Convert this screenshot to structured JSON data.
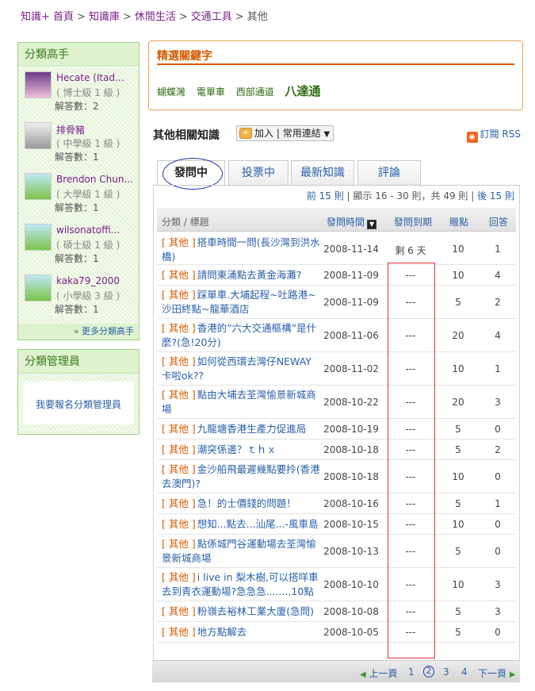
{
  "breadcrumb": [
    "知識+ 首頁",
    "知識庫",
    "休閒生活",
    "交通工具",
    "其他"
  ],
  "sidebar": {
    "experts_title": "分類高手",
    "experts": [
      {
        "name": "Hecate (Itad...",
        "grade": "( 博士級 1 級 )",
        "answers": "解答數：2",
        "avatar": "anime-girl-avatar"
      },
      {
        "name": "排骨豬",
        "grade": "( 中學級 1 級 )",
        "answers": "解答數：1",
        "avatar": "gray-doll-avatar"
      },
      {
        "name": "Brendon Chun...",
        "grade": "( 大學級 1 級 )",
        "answers": "解答數：1",
        "avatar": "green-creature-avatar"
      },
      {
        "name": "wilsonatoffi...",
        "grade": "( 碩士級 1 級 )",
        "answers": "解答數：1",
        "avatar": "green-creature-avatar"
      },
      {
        "name": "kaka79_2000",
        "grade": "( 小學級 3 級 )",
        "answers": "解答數：1",
        "avatar": "green-creature-avatar"
      }
    ],
    "more_experts": "更多分類高手",
    "admin_title": "分類管理員",
    "admin_link": "我要報名分類管理員"
  },
  "keywords": {
    "title": "精選關鍵字",
    "items": [
      "蝴蝶灣",
      "電單車",
      "西部通道"
    ],
    "featured": "八達通"
  },
  "section": {
    "title": "其他相關知識",
    "add_label": "加入",
    "links_label": "常用連結",
    "rss_label": "訂閱 RSS"
  },
  "tabs": [
    "發問中",
    "投票中",
    "最新知識",
    "評論"
  ],
  "pager_top": {
    "prev": "前 15 則",
    "info": "顯示 16 - 30 則，共 49 則",
    "next": "後 15 則"
  },
  "table": {
    "headers": {
      "category": "分類 / 標題",
      "date": "發問時間",
      "deadline": "發問到期",
      "points": "贈點",
      "answers": "回答"
    },
    "rows": [
      {
        "cat": "[ 其他 ]",
        "title": "搭車時間一問(長沙灣到洪水橋)",
        "date": "2008-11-14",
        "deadline": "剩 6 天",
        "points": "10",
        "answers": "1"
      },
      {
        "cat": "[ 其他 ]",
        "title": "請問東涌點去黃金海灘?",
        "date": "2008-11-09",
        "deadline": "---",
        "points": "10",
        "answers": "4"
      },
      {
        "cat": "[ 其他 ]",
        "title": "踩單車.大埔起程~吐路港~沙田終點~龍華酒店",
        "date": "2008-11-09",
        "deadline": "---",
        "points": "5",
        "answers": "2"
      },
      {
        "cat": "[ 其他 ]",
        "title": "香港的”六大交通樞構”是什麼?(急!20分)",
        "date": "2008-11-06",
        "deadline": "---",
        "points": "20",
        "answers": "4"
      },
      {
        "cat": "[ 其他 ]",
        "title": "如何從西環去灣仔NEWAY卡啦ok??",
        "date": "2008-11-02",
        "deadline": "---",
        "points": "10",
        "answers": "1"
      },
      {
        "cat": "[ 其他 ]",
        "title": "點由大埔去荃灣愉景新城商場",
        "date": "2008-10-22",
        "deadline": "---",
        "points": "20",
        "answers": "3"
      },
      {
        "cat": "[ 其他 ]",
        "title": "九龍塘香港生產力促進局",
        "date": "2008-10-19",
        "deadline": "---",
        "points": "5",
        "answers": "0"
      },
      {
        "cat": "[ 其他 ]",
        "title": "潮突係邊？ｔｈｘ",
        "date": "2008-10-18",
        "deadline": "---",
        "points": "5",
        "answers": "2"
      },
      {
        "cat": "[ 其他 ]",
        "title": "金沙船飛最遲幾點要拎(香港去澳門)?",
        "date": "2008-10-18",
        "deadline": "---",
        "points": "10",
        "answers": "0"
      },
      {
        "cat": "[ 其他 ]",
        "title": "急！的士價錢的問題！",
        "date": "2008-10-16",
        "deadline": "---",
        "points": "5",
        "answers": "1"
      },
      {
        "cat": "[ 其他 ]",
        "title": "想知...點去...汕尾...-風車島",
        "date": "2008-10-15",
        "deadline": "---",
        "points": "10",
        "answers": "0"
      },
      {
        "cat": "[ 其他 ]",
        "title": "點係城門谷運動場去荃灣愉景新城商場",
        "date": "2008-10-13",
        "deadline": "---",
        "points": "5",
        "answers": "0"
      },
      {
        "cat": "[ 其他 ]",
        "title": "i live in 梨木樹,可以搭咩車去到青衣運動場?急急急........10點",
        "date": "2008-10-10",
        "deadline": "---",
        "points": "10",
        "answers": "3"
      },
      {
        "cat": "[ 其他 ]",
        "title": "粉嶺去裕林工業大廈(急問)",
        "date": "2008-10-08",
        "deadline": "---",
        "points": "5",
        "answers": "3"
      },
      {
        "cat": "[ 其他 ]",
        "title": "地方點解去",
        "date": "2008-10-05",
        "deadline": "---",
        "points": "5",
        "answers": "0"
      }
    ]
  },
  "pager": {
    "prev": "上一頁",
    "pages": [
      "1",
      "2",
      "3",
      "4"
    ],
    "current": "2",
    "next": "下一頁"
  }
}
